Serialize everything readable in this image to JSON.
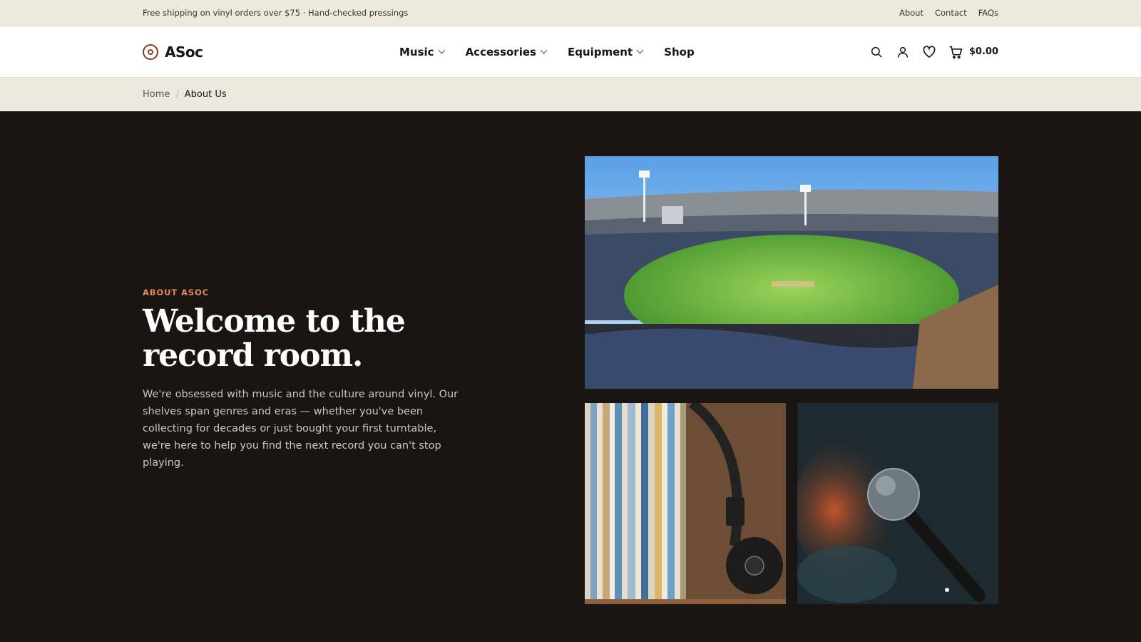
{
  "announcement": {
    "message": "Free shipping on vinyl orders over $75 · Hand-checked pressings",
    "links": [
      "About",
      "Contact",
      "FAQs"
    ]
  },
  "header": {
    "brand": "ASoc",
    "nav": [
      "Music",
      "Accessories",
      "Equipment",
      "Shop"
    ],
    "cart_total": "$0.00"
  },
  "breadcrumb": {
    "home": "Home",
    "separator": "/",
    "current": "About Us"
  },
  "hero": {
    "eyebrow": "ABOUT ASOC",
    "headline": "Welcome to the record room.",
    "body": "We're obsessed with music and the culture around vinyl. Our shelves span genres and eras — whether you've been collecting for decades or just bought your first turntable, we're here to help you find the next record you can't stop playing."
  },
  "colors": {
    "accent": "#e08a5a",
    "logo": "#8b3a2a",
    "hero_bg": "#1a1412",
    "bar_bg": "#efe8de"
  }
}
